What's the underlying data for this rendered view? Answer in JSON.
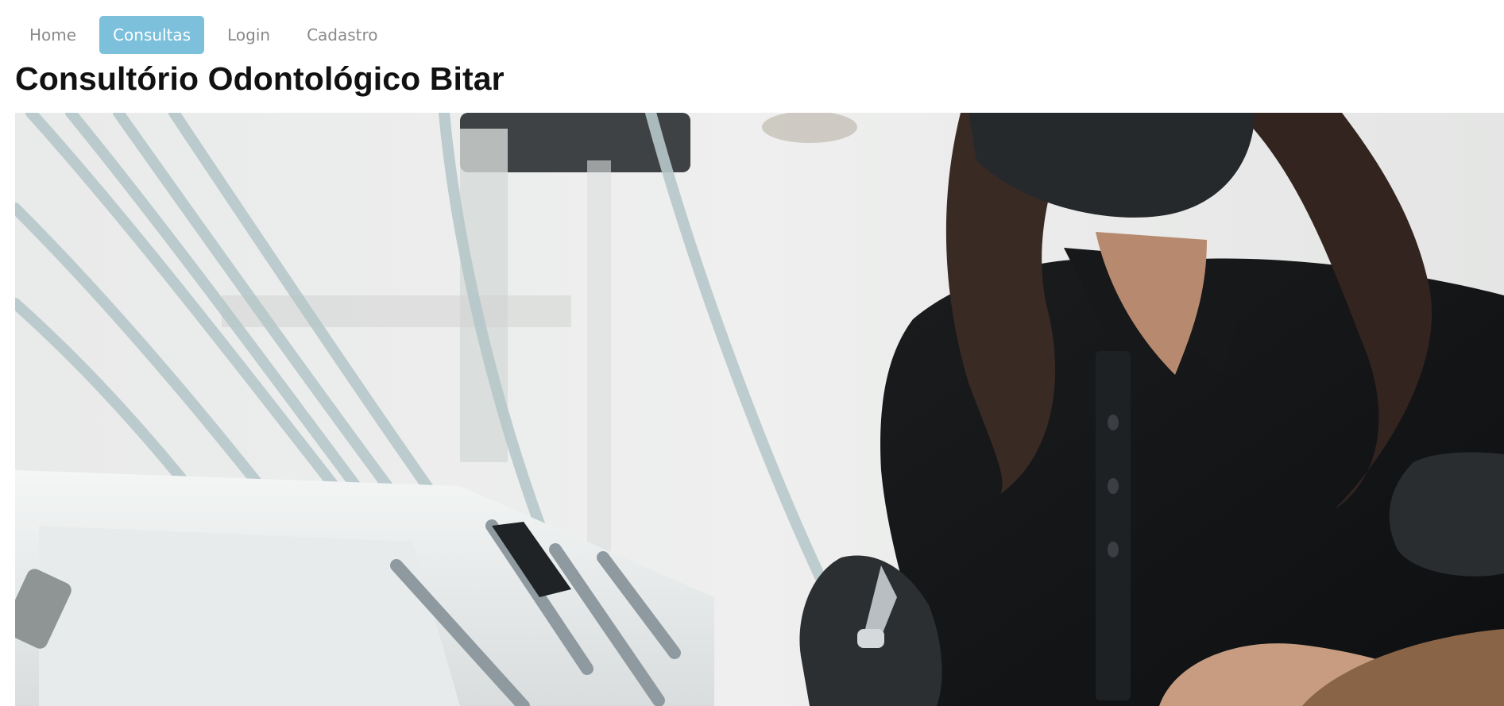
{
  "nav": {
    "items": [
      {
        "label": "Home",
        "active": false
      },
      {
        "label": "Consultas",
        "active": true
      },
      {
        "label": "Login",
        "active": false
      },
      {
        "label": "Cadastro",
        "active": false
      }
    ],
    "active_color": "#7cc0dc"
  },
  "header": {
    "title": "Consultório Odontológico Bitar"
  },
  "hero": {
    "image_description_icon": "dentist-photo"
  }
}
